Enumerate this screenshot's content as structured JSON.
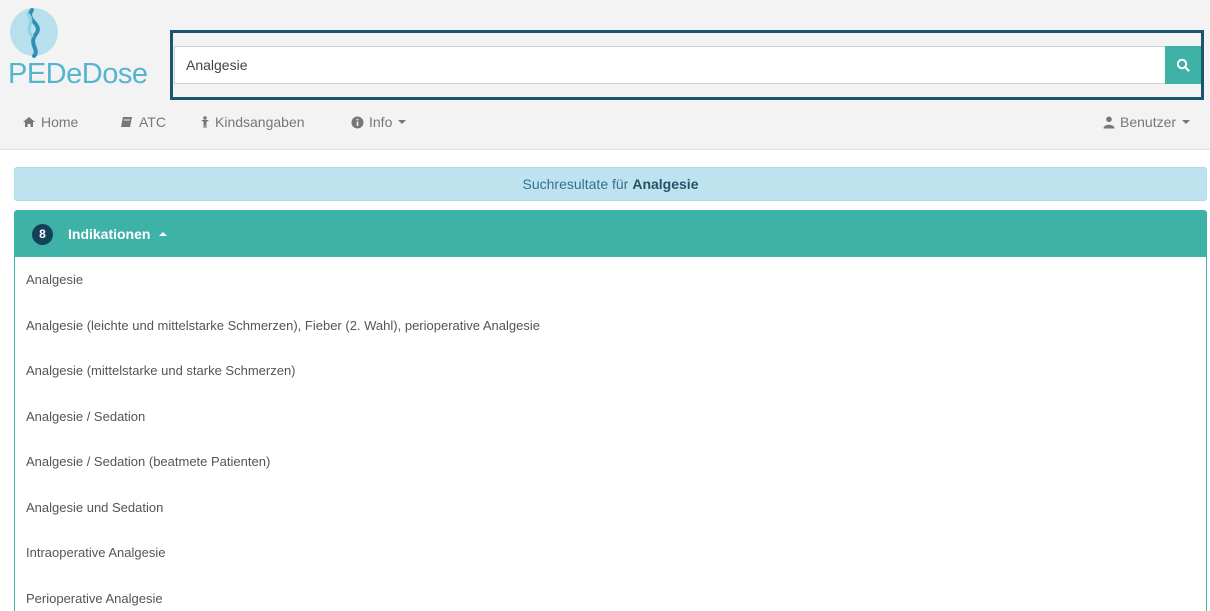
{
  "brand": {
    "name": "PEDeDose"
  },
  "search": {
    "value": "Analgesie"
  },
  "nav": {
    "home": "Home",
    "atc": "ATC",
    "kindsangaben": "Kindsangaben",
    "info": "Info",
    "benutzer": "Benutzer"
  },
  "results_banner": {
    "prefix": "Suchresultate für",
    "term": "Analgesie"
  },
  "indications": {
    "count": "8",
    "title": "Indikationen",
    "items": [
      "Analgesie",
      "Analgesie (leichte und mittelstarke Schmerzen), Fieber (2. Wahl), perioperative Analgesie",
      "Analgesie (mittelstarke und starke Schmerzen)",
      "Analgesie / Sedation",
      "Analgesie / Sedation (beatmete Patienten)",
      "Analgesie und Sedation",
      "Intraoperative Analgesie",
      "Perioperative Analgesie"
    ]
  },
  "colors": {
    "teal": "#3fb2a8",
    "navy": "#1d5570",
    "logo_blue": "#55b5cf",
    "alert_bg": "#bfe3ee"
  }
}
